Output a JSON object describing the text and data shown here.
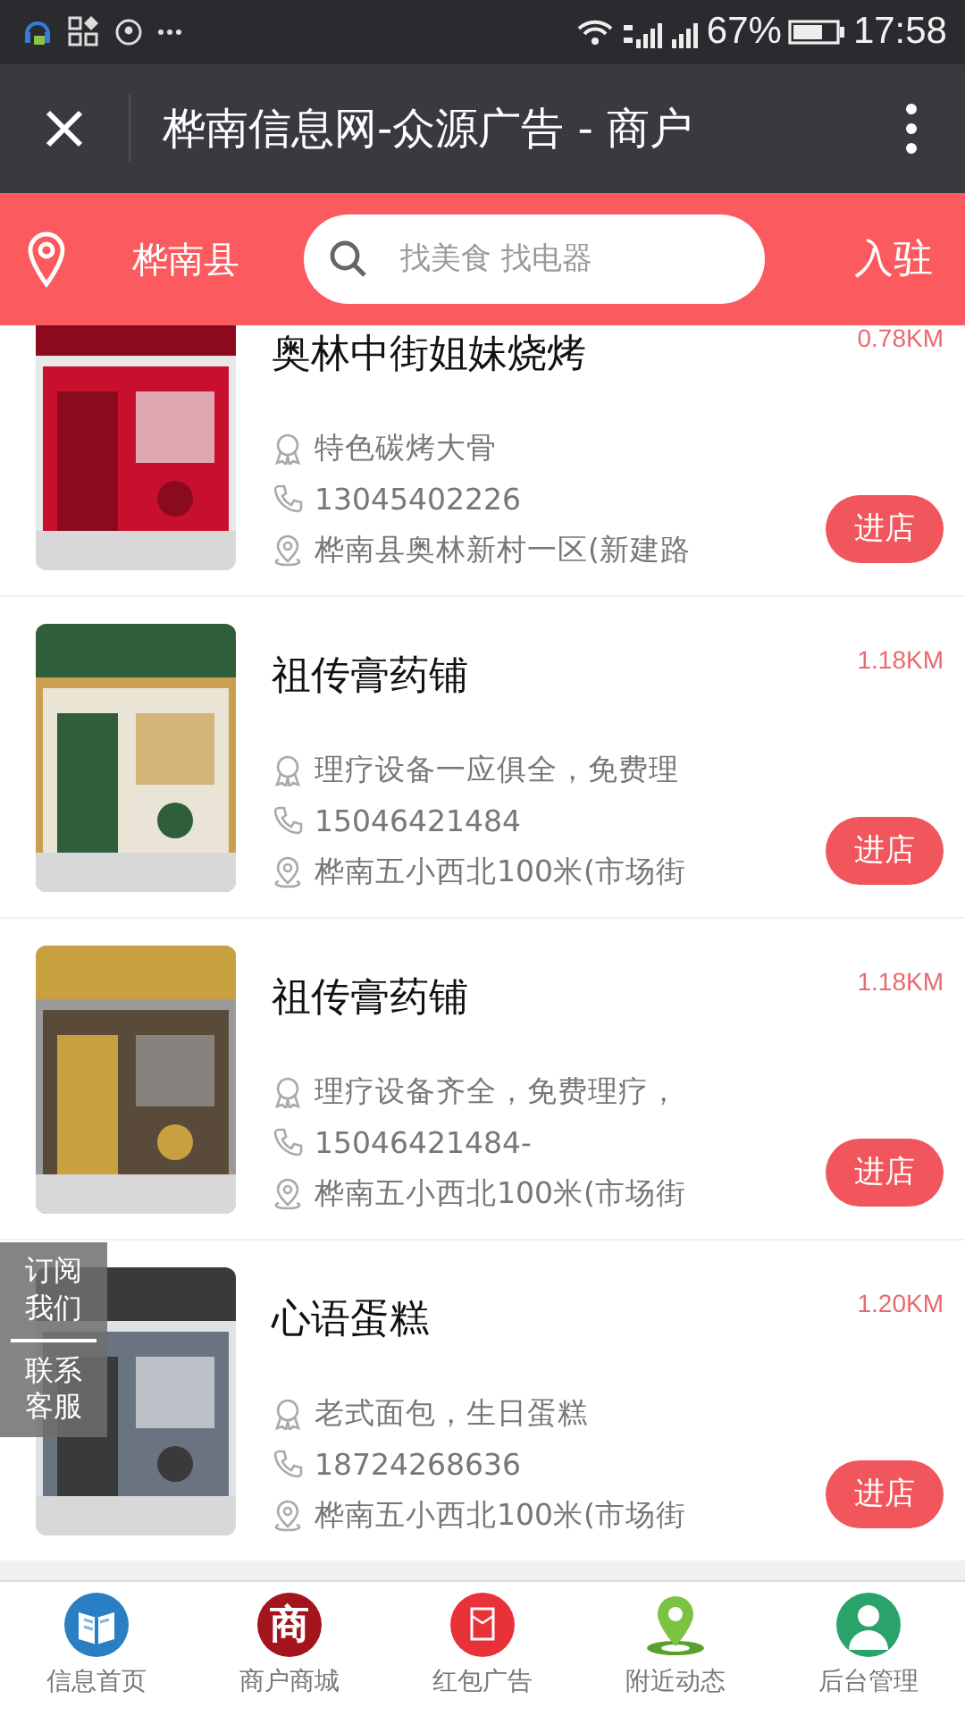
{
  "status_bar": {
    "battery_text": "67%",
    "time": "17:58"
  },
  "header": {
    "title": "桦南信息网-众源广告 - 商户"
  },
  "search_bar": {
    "location": "桦南县",
    "placeholder": "找美食 找电器",
    "join": "入驻"
  },
  "shops": [
    {
      "name": "奥林中街姐妹烧烤",
      "distance": "0.78KM",
      "feature": "特色碳烤大骨",
      "phone": "13045402226",
      "address": "桦南县奥林新村一区(新建路",
      "button": "进店",
      "kind": "picture"
    },
    {
      "name": "祖传膏药铺",
      "distance": "1.18KM",
      "feature": "理疗设备一应俱全，免费理",
      "phone": "15046421484",
      "address": "桦南五小西北100米(市场街",
      "button": "进店",
      "kind": "picture"
    },
    {
      "name": "祖传膏药铺",
      "distance": "1.18KM",
      "feature": "理疗设备齐全，免费理疗，",
      "phone": "15046421484-",
      "address": "桦南五小西北100米(市场街",
      "button": "进店",
      "kind": "picture"
    },
    {
      "name": "心语蛋糕",
      "distance": "1.20KM",
      "feature": "老式面包，生日蛋糕",
      "phone": "18724268636",
      "address": "桦南五小西北100米(市场街",
      "button": "进店",
      "kind": "picture"
    }
  ],
  "side_panel": [
    "订阅我们",
    "联系客服"
  ],
  "bottom_nav": [
    {
      "label": "信息首页",
      "kind": "book"
    },
    {
      "label": "商户商城",
      "kind": "shop",
      "icon_text": "商"
    },
    {
      "label": "红包广告",
      "kind": "envelope"
    },
    {
      "label": "附近动态",
      "kind": "pin"
    },
    {
      "label": "后台管理",
      "kind": "person"
    }
  ]
}
